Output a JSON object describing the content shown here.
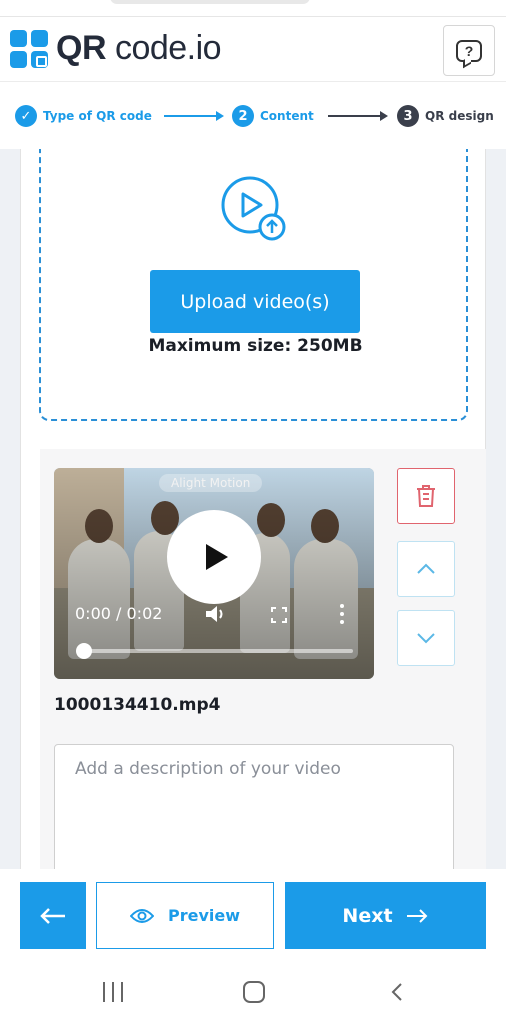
{
  "header": {
    "logo_text_bold": "QR",
    "logo_text_rest": " code.io",
    "help_symbol": "?"
  },
  "stepper": {
    "steps": [
      {
        "number": "✓",
        "label": "Type of QR code",
        "state": "done"
      },
      {
        "number": "2",
        "label": "Content",
        "state": "active"
      },
      {
        "number": "3",
        "label": "QR design",
        "state": "upcoming"
      }
    ]
  },
  "upload": {
    "button_label": "Upload video(s)",
    "max_size_text": "Maximum size: 250MB"
  },
  "video": {
    "watermark": "Alight Motion",
    "time": "0:00 / 0:02",
    "progress": 0,
    "filename": "1000134410.mp4",
    "description_value": "",
    "description_placeholder": "Add a description of your video"
  },
  "actions": {
    "preview_label": "Preview",
    "next_label": "Next"
  },
  "colors": {
    "accent": "#1b9be8",
    "danger": "#e0646e",
    "dark": "#3a3f4b"
  }
}
